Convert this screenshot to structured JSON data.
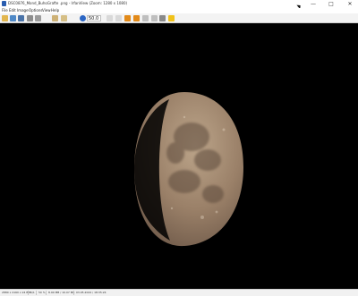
{
  "window": {
    "title": "DSC0876_Mond_BuhoGrafte .png - IrfanView (Zoom: 1280 x 1080)",
    "min": "—",
    "max": "□",
    "close": "✕"
  },
  "menu": [
    "File",
    "Edit",
    "Image",
    "Options",
    "View",
    "Help"
  ],
  "toolbar": {
    "zoom_value": "50.0",
    "icons": [
      "open-folder-icon",
      "thumbnails-icon",
      "save-icon",
      "print-icon",
      "delete-icon",
      "copy-icon",
      "paste-icon",
      "info-icon",
      "previous-icon",
      "next-icon",
      "back-arrow-icon",
      "forward-arrow-icon",
      "up-arrow-icon",
      "down-arrow-icon",
      "tools-icon",
      "star-icon"
    ]
  },
  "status": {
    "dimensions": "2880 x 2160 x 24 BPP",
    "index": "1/1",
    "zoom": "50 %",
    "size": "8.90 MB / 10.07 MB",
    "date": "03.05.2024 / 18:35:24"
  },
  "colors": {
    "canvas": "#000000",
    "moon_light": "#bca58a",
    "moon_dark": "#6d5848"
  }
}
